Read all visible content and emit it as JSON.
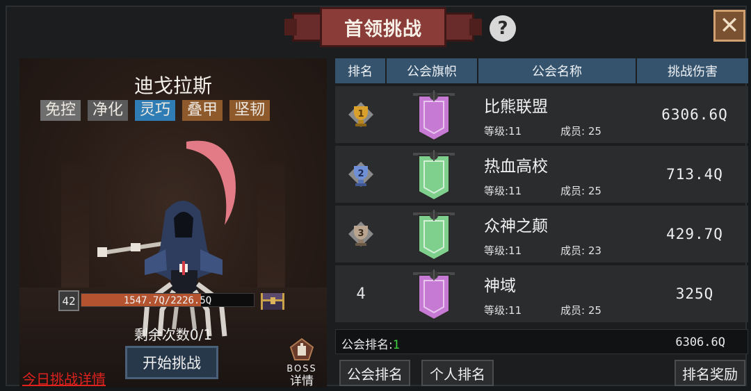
{
  "title": "首领挑战",
  "help_icon": "question-mark-icon",
  "close_icon": "close-icon",
  "boss": {
    "name": "迪戈拉斯",
    "tags": [
      {
        "label": "免控",
        "color": "#6e6e6e"
      },
      {
        "label": "净化",
        "color": "#5a5a5a"
      },
      {
        "label": "灵巧",
        "color": "#2f7db4"
      },
      {
        "label": "叠甲",
        "color": "#8e5a2c"
      },
      {
        "label": "坚韧",
        "color": "#8e5a2c"
      }
    ],
    "level": "42",
    "hp_text": "1547.7Q/2226.5Q",
    "hp_fraction": 0.695,
    "remaining": "剩余次数0/1",
    "start_button": "开始挑战",
    "today_link": "今日挑战详情",
    "boss_detail_top": "BOSS",
    "boss_detail_bottom": "详情"
  },
  "table": {
    "headers": [
      "排名",
      "公会旗帜",
      "公会名称",
      "挑战伤害"
    ],
    "rows": [
      {
        "rank": "1",
        "rank_icon": "gold-trophy-icon",
        "banner_color": "#c77ad3",
        "name": "比熊联盟",
        "level_label": "等级:11",
        "members_label": "成员: 25",
        "damage": "6306.6Q"
      },
      {
        "rank": "2",
        "rank_icon": "silver-trophy-icon",
        "banner_color": "#7fcf8d",
        "name": "热血高校",
        "level_label": "等级:11",
        "members_label": "成员: 25",
        "damage": "713.4Q"
      },
      {
        "rank": "3",
        "rank_icon": "bronze-trophy-icon",
        "banner_color": "#7fcf8d",
        "name": "众神之颠",
        "level_label": "等级:11",
        "members_label": "成员: 23",
        "damage": "429.7Q"
      },
      {
        "rank": "4",
        "rank_icon": "",
        "banner_color": "#c77ad3",
        "name": "神域",
        "level_label": "等级:11",
        "members_label": "成员: 25",
        "damage": "325Q"
      }
    ]
  },
  "my_guild": {
    "label": "公会排名:",
    "rank": "1",
    "damage": "6306.6Q"
  },
  "buttons": {
    "guild_rank": "公会排名",
    "personal_rank": "个人排名",
    "rank_reward": "排名奖励"
  }
}
